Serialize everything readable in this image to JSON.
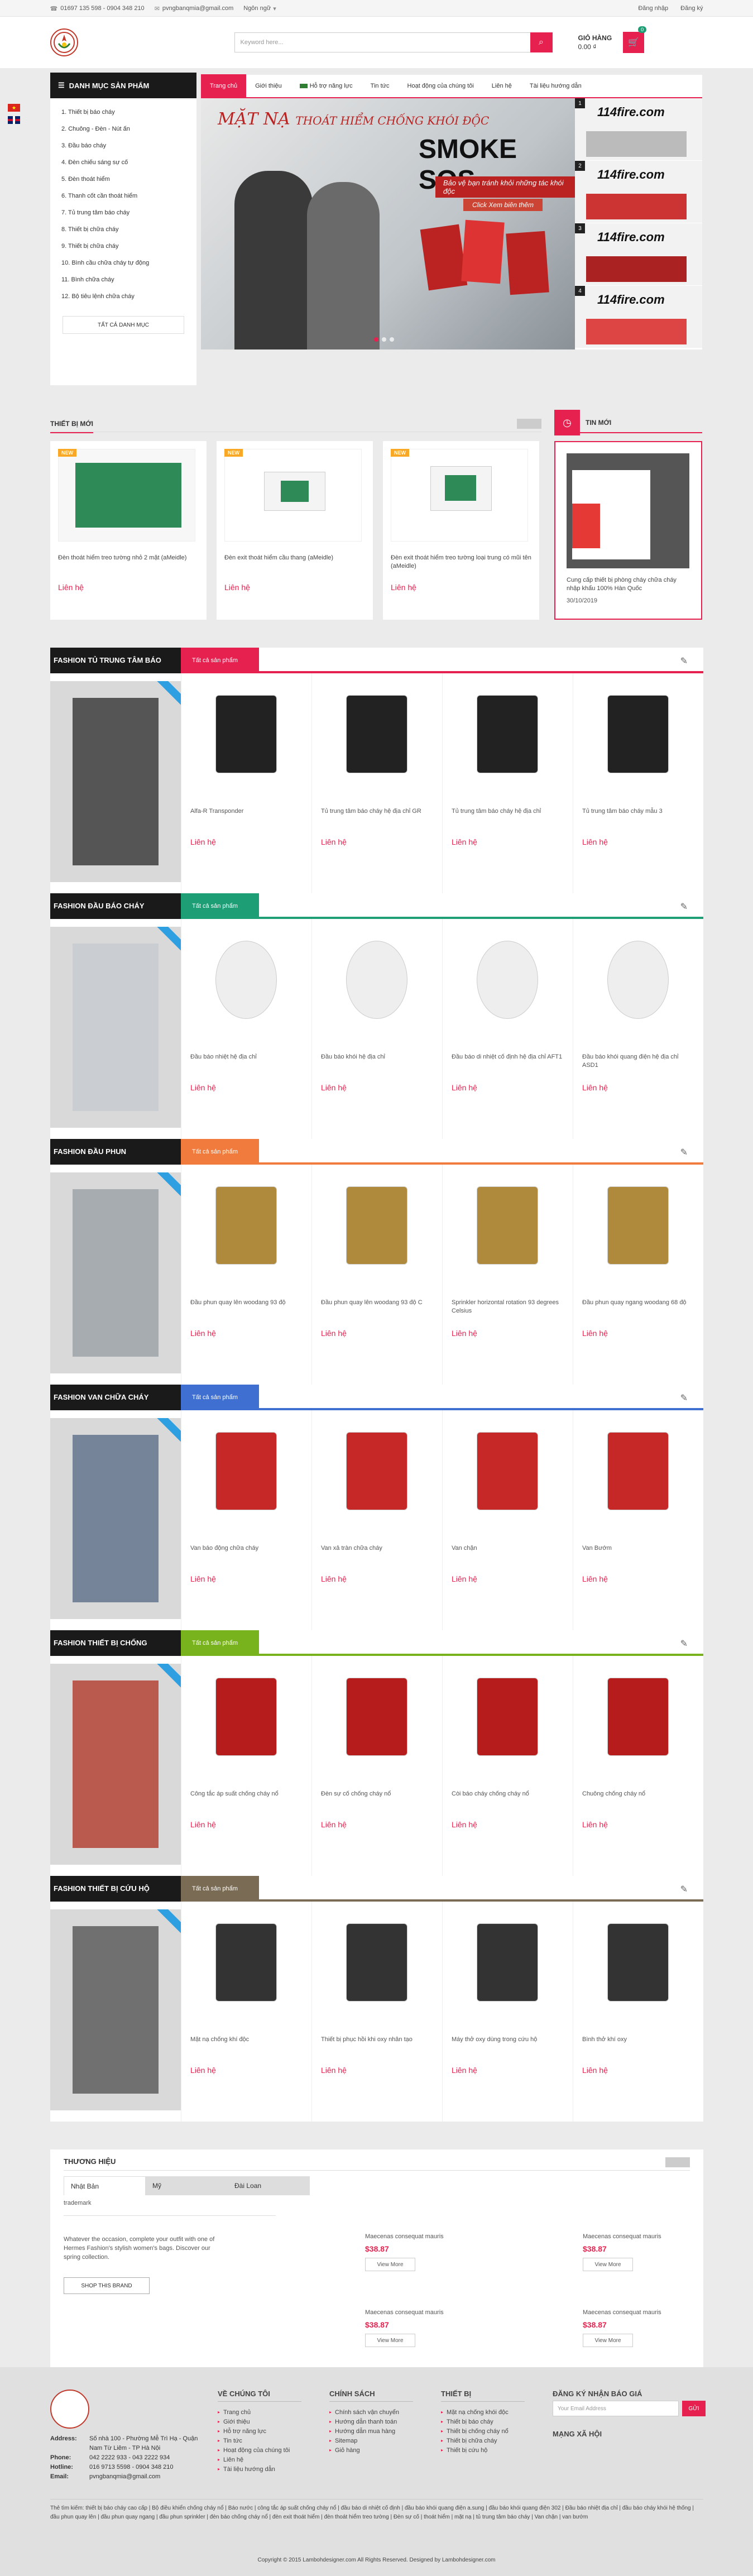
{
  "topbar": {
    "phone": "01697 135 598 - 0904 348 210",
    "email": "pvngbanqmia@gmail.com",
    "lang": "Ngôn ngữ",
    "login": "Đăng nhập",
    "register": "Đăng ký"
  },
  "header": {
    "search_placeholder": "Keyword here...",
    "cart_label": "GIỎ HÀNG",
    "cart_total": "0.00 ₫",
    "cart_count": "0"
  },
  "nav": {
    "category_title": "DANH MỤC SẢN PHẨM",
    "items": [
      "Trang chủ",
      "Giới thiệu",
      "Hỗ trợ năng lực",
      "Tin tức",
      "Hoạt động của chúng tôi",
      "Liên hệ",
      "Tài liệu hướng dẫn"
    ]
  },
  "categories": {
    "items": [
      "1. Thiết bị báo cháy",
      "2. Chuông - Đèn - Nút ấn",
      "3. Đầu báo cháy",
      "4. Đèn chiếu sáng sự cố",
      "5. Đèn thoát hiểm",
      "6. Thanh cốt cần thoát hiểm",
      "7. Tủ trung tâm báo cháy",
      "8. Thiết bị chữa cháy",
      "9. Thiết bị chữa cháy",
      "10. Bình cầu chữa cháy tự động",
      "11. Bình chữa cháy",
      "12. Bộ tiêu lệnh chữa cháy"
    ],
    "all_label": "TẤT CẢ DANH MỤC"
  },
  "slider": {
    "title": "MẶT NẠ",
    "title_sub": "THOÁT HIỂM CHỐNG KHÓI ĐỘC",
    "brand": "SMOKE SOS",
    "subline": "Bảo vệ bạn tránh khỏi những tác khói độc",
    "cta": "Click Xem biên thêm",
    "thumb_brand": "114fire.com",
    "thumb_numbers": [
      "1",
      "2",
      "3",
      "4"
    ]
  },
  "new_products": {
    "heading": "THIẾT BỊ MỚI",
    "badge": "NEW",
    "items": [
      {
        "name": "Đèn thoát hiểm treo tường nhỏ 2 mặt (aMeidle)",
        "price": "Liên hệ"
      },
      {
        "name": "Đèn exit thoát hiểm cầu thang (aMeidle)",
        "price": "Liên hệ"
      },
      {
        "name": "Đèn exit thoát hiểm treo tường loại trung có mũi tên (aMeidle)",
        "price": "Liên hệ"
      }
    ]
  },
  "news": {
    "heading": "TIN MỚI",
    "title": "Cung cấp thiết bị phòng cháy chữa cháy nhập khẩu 100% Hàn Quốc",
    "date": "30/10/2019"
  },
  "blocks": [
    {
      "name": "FASHION TỦ TRUNG TÂM BÁO",
      "all": "Tất cả sản phẩm",
      "color": "#e6214f",
      "items": [
        {
          "name": "Alfa-R Transponder",
          "price": "Liên hệ"
        },
        {
          "name": "Tủ trung tâm báo cháy hệ địa chỉ GR",
          "price": "Liên hệ"
        },
        {
          "name": "Tủ trung tâm báo cháy hệ địa chỉ",
          "price": "Liên hệ"
        },
        {
          "name": "Tủ trung tâm báo cháy mẫu 3",
          "price": "Liên hệ"
        }
      ]
    },
    {
      "name": "FASHION ĐẦU BÁO CHÁY",
      "all": "Tất cả sản phẩm",
      "color": "#1d9e74",
      "items": [
        {
          "name": "Đầu báo nhiệt hệ địa chỉ",
          "price": "Liên hệ"
        },
        {
          "name": "Đầu báo khói hệ địa chỉ",
          "price": "Liên hệ"
        },
        {
          "name": "Đầu báo di nhiệt cố định hệ địa chỉ AFT1",
          "price": "Liên hệ"
        },
        {
          "name": "Đầu báo khói quang điện hệ địa chỉ ASD1",
          "price": "Liên hệ"
        }
      ]
    },
    {
      "name": "FASHION ĐẦU PHUN",
      "all": "Tất cả sản phẩm",
      "color": "#f07b3c",
      "items": [
        {
          "name": "Đầu phun quay lên woodang 93 độ",
          "price": "Liên hệ"
        },
        {
          "name": "Đầu phun quay lên woodang 93 độ C",
          "price": "Liên hệ"
        },
        {
          "name": "Sprinkler horizontal rotation 93 degrees Celsius",
          "price": "Liên hệ"
        },
        {
          "name": "Đầu phun quay ngang woodang 68 độ",
          "price": "Liên hệ"
        }
      ]
    },
    {
      "name": "FASHION VAN CHỮA CHÁY",
      "all": "Tất cả sản phẩm",
      "color": "#3f6fd0",
      "items": [
        {
          "name": "Van báo động chữa cháy",
          "price": "Liên hệ"
        },
        {
          "name": "Van xả tràn chữa cháy",
          "price": "Liên hệ"
        },
        {
          "name": "Van chặn",
          "price": "Liên hệ"
        },
        {
          "name": "Van Bướm",
          "price": "Liên hệ"
        }
      ]
    },
    {
      "name": "FASHION THIẾT BỊ CHỐNG",
      "all": "Tất cả sản phẩm",
      "color": "#78b31e",
      "items": [
        {
          "name": "Công tắc áp suất chống cháy nổ",
          "price": "Liên hệ"
        },
        {
          "name": "Đèn sự cố chống cháy nổ",
          "price": "Liên hệ"
        },
        {
          "name": "Còi báo cháy chống cháy nổ",
          "price": "Liên hệ"
        },
        {
          "name": "Chuông chống cháy nổ",
          "price": "Liên hệ"
        }
      ]
    },
    {
      "name": "FASHION THIẾT BỊ CỨU HỘ",
      "all": "Tất cả sản phẩm",
      "color": "#7a6b54",
      "items": [
        {
          "name": "Mặt nạ chống khí độc",
          "price": "Liên hệ"
        },
        {
          "name": "Thiết bị phục hồi khi oxy nhân tạo",
          "price": "Liên hệ"
        },
        {
          "name": "Máy thở oxy dùng trong cứu hộ",
          "price": "Liên hệ"
        },
        {
          "name": "Bình thở khí oxy",
          "price": "Liên hệ"
        }
      ]
    }
  ],
  "brands": {
    "heading": "THƯƠNG HIỆU",
    "tabs": [
      "Nhật Bản",
      "Mỹ",
      "Đài Loan"
    ],
    "trademark": "trademark",
    "text": "Whatever the occasion, complete your outfit with one of Hermes Fashion's stylish women's bags. Discover our spring collection.",
    "shop_button": "SHOP THIS BRAND",
    "products": [
      {
        "name": "Maecenas consequat mauris",
        "price": "$38.87",
        "btn": "View More"
      },
      {
        "name": "Maecenas consequat mauris",
        "price": "$38.87",
        "btn": "View More"
      },
      {
        "name": "Maecenas consequat mauris",
        "price": "$38.87",
        "btn": "View More"
      },
      {
        "name": "Maecenas consequat mauris",
        "price": "$38.87",
        "btn": "View More"
      }
    ]
  },
  "footer": {
    "col1_title": "VỀ CHÚNG TÔI",
    "col1": [
      "Trang chủ",
      "Giới thiệu",
      "Hỗ trợ năng lực",
      "Tin tức",
      "Hoạt động của chúng tôi",
      "Liên hệ",
      "Tài liệu hướng dẫn"
    ],
    "col2_title": "CHÍNH SÁCH",
    "col2": [
      "Chính sách vận chuyển",
      "Hướng dẫn thanh toán",
      "Hướng dẫn mua hàng",
      "Sitemap",
      "Giỏ hàng"
    ],
    "col3_title": "THIẾT BỊ",
    "col3": [
      "Mặt nạ chống khói độc",
      "Thiết bị báo cháy",
      "Thiết bị chống cháy nổ",
      "Thiết bị chữa cháy",
      "Thiết bị cứu hộ"
    ],
    "subscribe_title": "ĐĂNG KÝ NHẬN BÁO GIÁ",
    "subscribe_placeholder": "Your Email Address",
    "subscribe_btn": "GỬI",
    "social_title": "MẠNG XÃ HỘI",
    "address_label": "Address:",
    "address": "Số nhà 100 - Phường Mễ Trì Hạ - Quận Nam Từ Liêm - TP Hà Nội",
    "phone_label": "Phone:",
    "phone": "042 2222 933 - 043 2222 934",
    "hotline_label": "Hotline:",
    "hotline": "016 9713 5598 - 0904 348 210",
    "email_label": "Email:",
    "email": "pvngbanqmia@gmail.com",
    "tags": "Thẻ tìm kiếm: thiết bị báo cháy cao cấp | Bộ điều khiển chống cháy nổ | Báo nước | công tắc áp suất chống cháy nổ | đầu báo di nhiệt cố định | đầu báo khói quang điện a.sung | đầu báo khói quang điện 302 | Đầu báo nhiệt địa chỉ | đầu báo cháy khói hệ thống | đầu phun quay lên | đầu phun quay ngang | đầu phun sprinkler | đèn báo chống cháy nổ | đèn exit thoát hiểm | đèn thoát hiểm treo tường | Đèn sự cố | thoát hiểm | mặt nạ | tủ trung tâm báo cháy | Van chặn | van bướm",
    "copyright": "Copyright © 2015 Lambohdesigner.com All Rights Reserved. Designed by Lambohdesigner.com"
  },
  "colors": {
    "accent": "#e6214f",
    "dark": "#1a1a1a"
  }
}
